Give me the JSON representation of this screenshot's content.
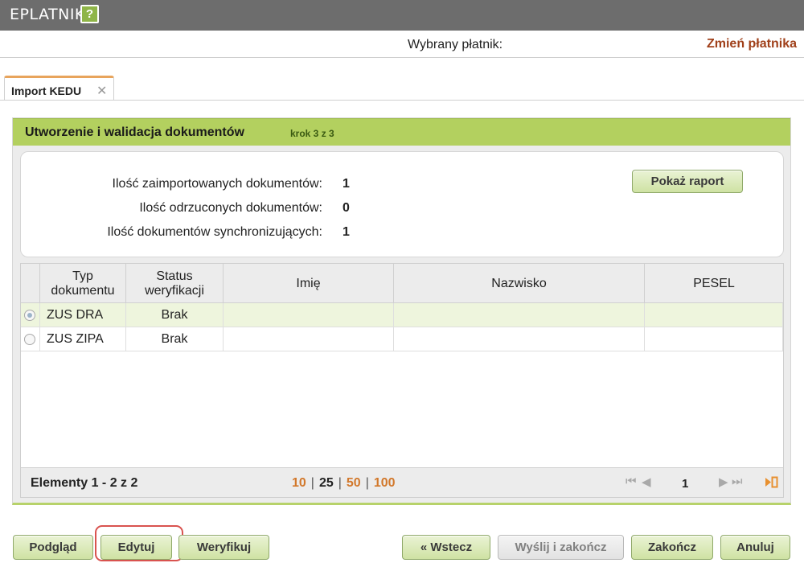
{
  "app": {
    "title": "EPLATNIK",
    "help_symbol": "?"
  },
  "payer": {
    "label": "Wybrany płatnik:",
    "change_link": "Zmień płatnika"
  },
  "tabs": [
    {
      "label": "Import KEDU",
      "close_symbol": "✕"
    }
  ],
  "panel": {
    "title": "Utworzenie i walidacja dokumentów",
    "step": "krok 3 z 3",
    "stats": [
      {
        "label": "Ilość zaimportowanych dokumentów:",
        "value": "1"
      },
      {
        "label": "Ilość odrzuconych dokumentów:",
        "value": "0"
      },
      {
        "label": "Ilość dokumentów synchronizujących:",
        "value": "1"
      }
    ],
    "report_button": "Pokaż raport"
  },
  "grid": {
    "columns": [
      {
        "line1": "Typ",
        "line2": "dokumentu"
      },
      {
        "line1": "Status",
        "line2": "weryfikacji"
      },
      {
        "line1": "Imię",
        "line2": ""
      },
      {
        "line1": "Nazwisko",
        "line2": ""
      },
      {
        "line1": "PESEL",
        "line2": ""
      }
    ],
    "rows": [
      {
        "type": "ZUS DRA",
        "status": "Brak",
        "first_name": "",
        "last_name": "",
        "pesel": "",
        "selected": true
      },
      {
        "type": "ZUS ZIPA",
        "status": "Brak",
        "first_name": "",
        "last_name": "",
        "pesel": "",
        "selected": false
      }
    ],
    "footer": {
      "count_text": "Elementy 1 - 2 z 2",
      "page_sizes": [
        "10",
        "25",
        "50",
        "100"
      ],
      "active_page_size": "25",
      "page": "1"
    }
  },
  "buttons": {
    "preview": "Podgląd",
    "edit": "Edytuj",
    "verify": "Weryfikuj",
    "back": "« Wstecz",
    "send_finish": "Wyślij i zakończ",
    "finish": "Zakończ",
    "cancel": "Anuluj"
  },
  "colors": {
    "accent_green": "#b3d05f",
    "link_orange": "#d2782b",
    "change_link": "#a0401a",
    "highlight": "#d9534f"
  }
}
